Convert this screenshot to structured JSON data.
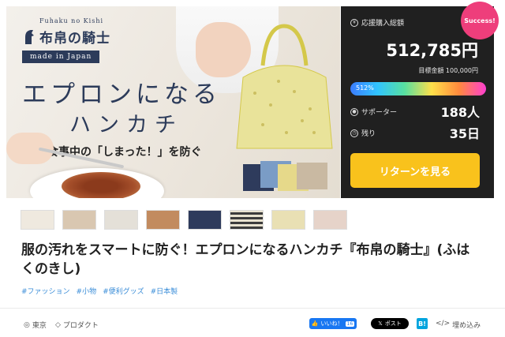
{
  "hero": {
    "brand_romaji": "Fuhaku no Kishi",
    "brand_name": "布帛の騎士",
    "made_in": "made in Japan",
    "headline1": "エプロンになる",
    "headline2": "ハンカチ",
    "tagline": "お食事中の「しまった！」を防ぐ",
    "hanky_colors": [
      "#2e3b5c",
      "#7a9cc6",
      "#e6d98a",
      "#c9b9a2"
    ]
  },
  "stats": {
    "badge": "Success!",
    "purchase_label": "応援購入総額",
    "amount": "512,785円",
    "goal": "目標金額 100,000円",
    "progress_label": "512%",
    "supporters_label": "サポーター",
    "supporters_value": "188人",
    "remaining_label": "残り",
    "remaining_value": "35日",
    "return_button": "リターンを見る"
  },
  "thumbnails": [
    {
      "color": "#efe9df"
    },
    {
      "color": "#d9c7b1"
    },
    {
      "color": "#e4e0d8"
    },
    {
      "color": "#c28b5f"
    },
    {
      "color": "#2e3b5c"
    },
    {
      "color": "#3c3c3c"
    },
    {
      "color": "#e9e0b4"
    },
    {
      "color": "#e6d3c9"
    }
  ],
  "title": "服の汚れをスマートに防ぐ！エプロンになるハンカチ『布帛の騎士』(ふはくのきし)",
  "tags": [
    "#ファッション",
    "#小物",
    "#便利グッズ",
    "#日本製"
  ],
  "footer": {
    "location": "東京",
    "category": "プロダクト",
    "like_label": "いいね！",
    "like_count": "16",
    "post_label": "ポスト",
    "hatena_label": "B!",
    "embed_label": "埋め込み"
  }
}
